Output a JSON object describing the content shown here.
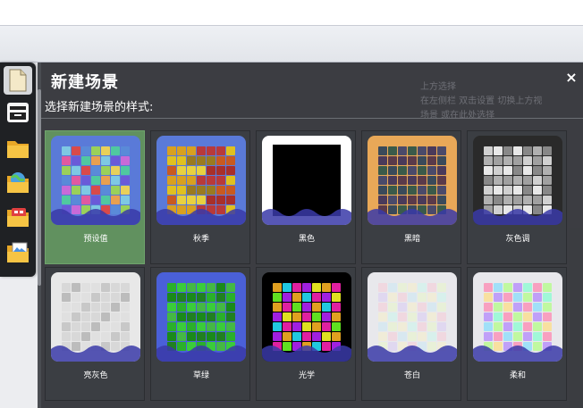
{
  "dialog": {
    "title": "新建场景",
    "subtitle": "选择新建场景的样式:",
    "close": "×"
  },
  "sidebar": {
    "items": [
      {
        "name": "document-icon"
      },
      {
        "name": "archive-icon"
      },
      {
        "name": "folder-icon"
      },
      {
        "name": "globe-folder-icon"
      },
      {
        "name": "sprite-folder-icon"
      },
      {
        "name": "image-folder-icon"
      }
    ]
  },
  "scenes": [
    {
      "label": "预设值",
      "bg": "#5a7ad8",
      "colors": [
        "#7ec8e3",
        "#e05aa0",
        "#9ad05a",
        "#e8a050",
        "#5a8ad8",
        "#c86ad8",
        "#50c8a0",
        "#d84a4a",
        "#6a5ad8",
        "#e8d05a"
      ],
      "selected": true
    },
    {
      "label": "秋季",
      "bg": "#5a7ad8",
      "colors": [
        "#d8a020",
        "#b83a3a",
        "#e0c020",
        "#9a7a20",
        "#c85a20",
        "#e8d040",
        "#a8302a"
      ],
      "selected": false
    },
    {
      "label": "黑色",
      "bg": "#000000",
      "frame": "#ffffff",
      "colors": [],
      "selected": false
    },
    {
      "label": "黑暗",
      "bg": "#e8a858",
      "colors": [
        "#3a4a5a",
        "#4a3a5a",
        "#3a5a4a",
        "#5a3a4a",
        "#4a4a6a"
      ],
      "selected": false
    },
    {
      "label": "灰色调",
      "bg": "#2a2a2a",
      "colors": [
        "#d0d0d0",
        "#b0b0b0",
        "#e8e8e8",
        "#a0a0a0",
        "#888888"
      ],
      "selected": false
    },
    {
      "label": "亮灰色",
      "bg": "#e8e8e8",
      "colors": [
        "#d8d8d8",
        "#c8c8c8",
        "#e0e0e0",
        "#bcbcbc"
      ],
      "selected": false
    },
    {
      "label": "草绿",
      "bg": "#4a60d8",
      "colors": [
        "#2ab02a",
        "#1a8a1a",
        "#3acc3a",
        "#208020",
        "#44b844"
      ],
      "selected": false
    },
    {
      "label": "光学",
      "bg": "#000000",
      "colors": [
        "#e0a020",
        "#20c8e0",
        "#e020a0",
        "#60e020",
        "#a020e0",
        "#e0e020"
      ],
      "selected": false
    },
    {
      "label": "苍白",
      "bg": "#e8e8ec",
      "colors": [
        "#f0d8e0",
        "#d8e8f0",
        "#e8f0d8",
        "#e0d8f0",
        "#f0ecd8",
        "#d8f0ec"
      ],
      "selected": false
    },
    {
      "label": "柔和",
      "bg": "#e8e8ec",
      "colors": [
        "#f8a0c0",
        "#a0e0f8",
        "#c0f8a0",
        "#f8e0a0",
        "#c0a0f8",
        "#a0f8d8"
      ],
      "selected": false
    }
  ],
  "ghost_text": [
    "上方选择",
    "在左侧栏 双击设置 切换上方视",
    "场景 或在此处选择"
  ]
}
